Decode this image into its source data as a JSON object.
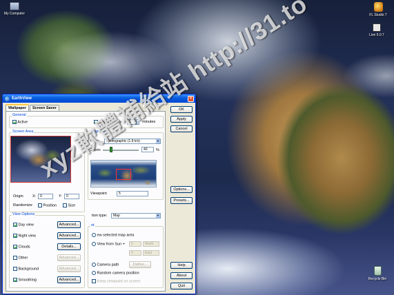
{
  "desktop": {
    "icons": [
      {
        "label": "My Computer"
      },
      {
        "label": "FL Studio 7"
      },
      {
        "label": "Live 6.0.7"
      },
      {
        "label": "Recycle Bin"
      }
    ]
  },
  "window": {
    "title": "EarthView",
    "tabs": [
      "Wallpaper",
      "Screen Saver"
    ],
    "general": {
      "label": "General",
      "active_label": "Active",
      "active_checked": true,
      "update_label": "Update every",
      "update_checked": true,
      "update_value": "5",
      "update_unit": "minutes"
    },
    "screen_area": {
      "label": "Screen Area",
      "origin_label": "Origin",
      "x_label": "X:",
      "x_value": "0",
      "y_label": "Y:",
      "y_value": "0",
      "randomize_label": "Randomize",
      "position_label": "Position",
      "size_label": "Size"
    },
    "map_area": {
      "label": "Map Area",
      "map_label": "Map:",
      "map_value": "Photographic (1.8 k/s)",
      "zoom_label": "Zoom:",
      "zoom_value": "40",
      "zoom_unit": "%",
      "viewpoint_label": "Viewpoint",
      "viewpoint_value": "5"
    },
    "view_options": {
      "label": "View Options",
      "items": [
        {
          "label": "Day view",
          "checked": true,
          "button": "Advanced..."
        },
        {
          "label": "Night view",
          "checked": true,
          "button": "Advanced..."
        },
        {
          "label": "Clouds",
          "checked": true,
          "button": "Details..."
        },
        {
          "label": "Other",
          "checked": false,
          "button": "Advanced..."
        },
        {
          "label": "Background",
          "checked": false,
          "button": "Advanced..."
        },
        {
          "label": "Smoothing",
          "checked": true,
          "button": "Advanced..."
        }
      ]
    },
    "projection": {
      "type_label": "tion type:",
      "type_value": "Map",
      "section_label": "nt",
      "selected_label": "ew selected map area",
      "view_from_sun": "View from Sun +",
      "deg1": "0",
      "dir1": "North",
      "deg2": "0",
      "dir2": "East",
      "camera_path": "Camera path",
      "define_button": "Define...",
      "random_camera": "Random camera position",
      "keep_viewpoint": "Keep viewpoint on screen"
    },
    "side_buttons": {
      "ok": "OK",
      "apply": "Apply",
      "cancel": "Cancel",
      "options": "Options...",
      "presets": "Presets...",
      "help": "Help",
      "about": "About",
      "quit": "Quit"
    }
  },
  "watermark": "xyz軟體補給站 http://31.to"
}
